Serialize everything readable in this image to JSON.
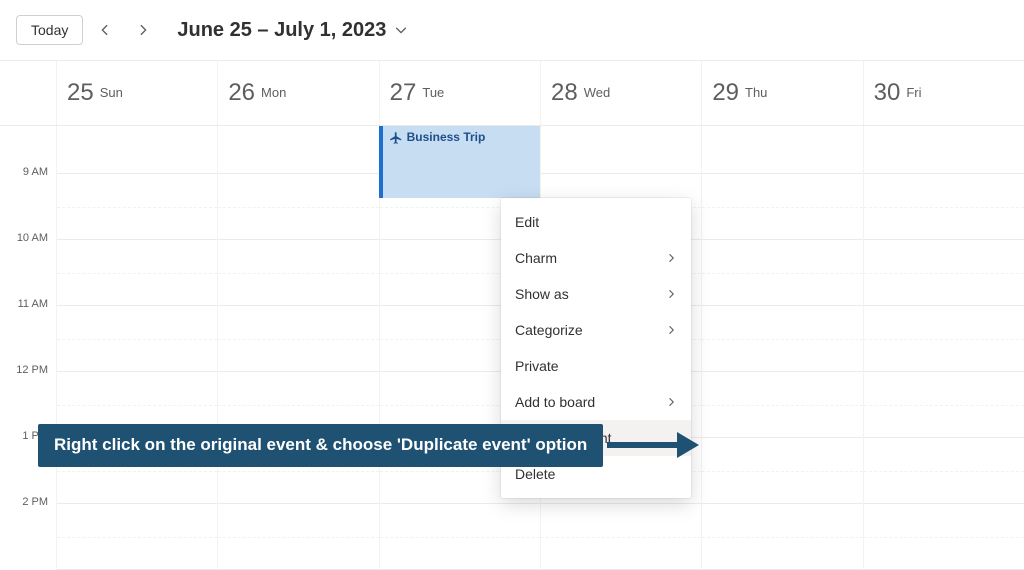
{
  "toolbar": {
    "today_label": "Today",
    "date_range": "June 25 – July 1, 2023"
  },
  "days": [
    {
      "num": "25",
      "name": "Sun"
    },
    {
      "num": "26",
      "name": "Mon"
    },
    {
      "num": "27",
      "name": "Tue"
    },
    {
      "num": "28",
      "name": "Wed"
    },
    {
      "num": "29",
      "name": "Thu"
    },
    {
      "num": "30",
      "name": "Fri"
    }
  ],
  "time_labels": [
    "9 AM",
    "10 AM",
    "11 AM",
    "12 PM",
    "1 PM",
    "2 PM"
  ],
  "event": {
    "title": "Business Trip"
  },
  "context_menu": {
    "edit": "Edit",
    "charm": "Charm",
    "show_as": "Show as",
    "categorize": "Categorize",
    "private": "Private",
    "add_to_board": "Add to board",
    "duplicate": "Duplicate event",
    "delete": "Delete"
  },
  "callout": {
    "text": "Right click on the original event & choose 'Duplicate event' option"
  },
  "colors": {
    "event_bg": "#c7ddf2",
    "event_border": "#1f6fd0",
    "callout_bg": "#1f5173"
  }
}
